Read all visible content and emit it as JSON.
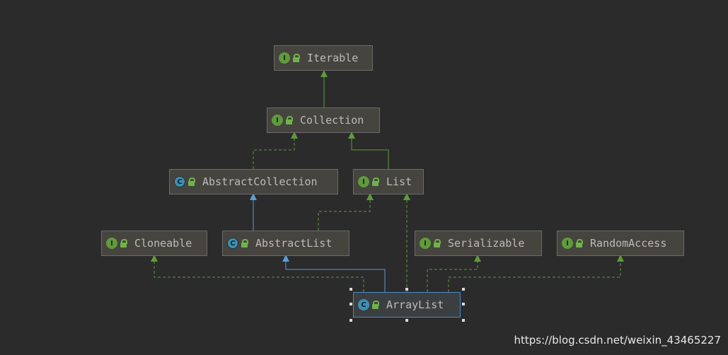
{
  "nodes": {
    "iterable": {
      "label": "Iterable",
      "kind": "I"
    },
    "collection": {
      "label": "Collection",
      "kind": "I"
    },
    "abstract_collection": {
      "label": "AbstractCollection",
      "kind": "C"
    },
    "list": {
      "label": "List",
      "kind": "I"
    },
    "cloneable": {
      "label": "Cloneable",
      "kind": "I"
    },
    "abstract_list": {
      "label": "AbstractList",
      "kind": "C"
    },
    "serializable": {
      "label": "Serializable",
      "kind": "I"
    },
    "random_access": {
      "label": "RandomAccess",
      "kind": "I"
    },
    "array_list": {
      "label": "ArrayList",
      "kind": "C"
    }
  },
  "colors": {
    "background": "#2b2b2b",
    "implements_edge": "#5f9a3c",
    "extends_edge": "#5b9bd5",
    "selection": "#4a88c7"
  },
  "watermark": "https://blog.csdn.net/weixin_43465227"
}
